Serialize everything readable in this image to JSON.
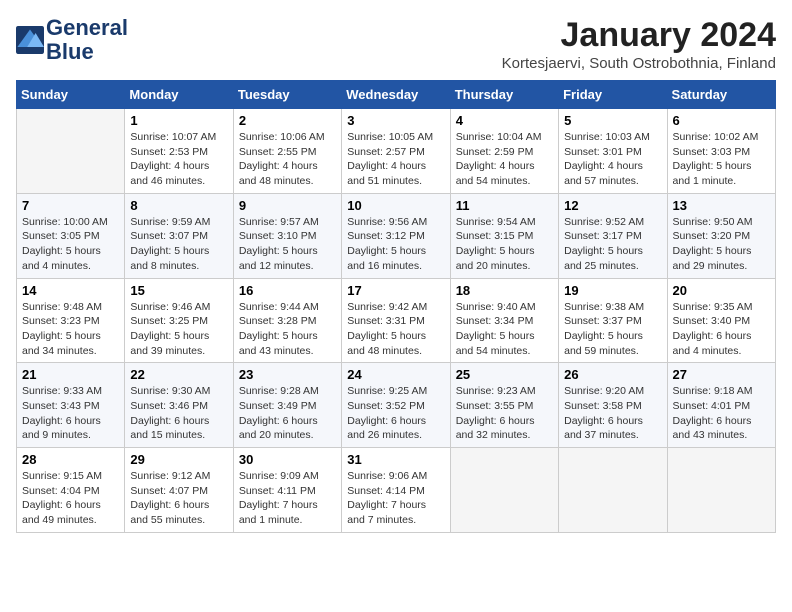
{
  "logo": {
    "line1": "General",
    "line2": "Blue"
  },
  "title": "January 2024",
  "subtitle": "Kortesjaervi, South Ostrobothnia, Finland",
  "weekdays": [
    "Sunday",
    "Monday",
    "Tuesday",
    "Wednesday",
    "Thursday",
    "Friday",
    "Saturday"
  ],
  "weeks": [
    [
      {
        "day": "",
        "info": ""
      },
      {
        "day": "1",
        "info": "Sunrise: 10:07 AM\nSunset: 2:53 PM\nDaylight: 4 hours\nand 46 minutes."
      },
      {
        "day": "2",
        "info": "Sunrise: 10:06 AM\nSunset: 2:55 PM\nDaylight: 4 hours\nand 48 minutes."
      },
      {
        "day": "3",
        "info": "Sunrise: 10:05 AM\nSunset: 2:57 PM\nDaylight: 4 hours\nand 51 minutes."
      },
      {
        "day": "4",
        "info": "Sunrise: 10:04 AM\nSunset: 2:59 PM\nDaylight: 4 hours\nand 54 minutes."
      },
      {
        "day": "5",
        "info": "Sunrise: 10:03 AM\nSunset: 3:01 PM\nDaylight: 4 hours\nand 57 minutes."
      },
      {
        "day": "6",
        "info": "Sunrise: 10:02 AM\nSunset: 3:03 PM\nDaylight: 5 hours\nand 1 minute."
      }
    ],
    [
      {
        "day": "7",
        "info": "Sunrise: 10:00 AM\nSunset: 3:05 PM\nDaylight: 5 hours\nand 4 minutes."
      },
      {
        "day": "8",
        "info": "Sunrise: 9:59 AM\nSunset: 3:07 PM\nDaylight: 5 hours\nand 8 minutes."
      },
      {
        "day": "9",
        "info": "Sunrise: 9:57 AM\nSunset: 3:10 PM\nDaylight: 5 hours\nand 12 minutes."
      },
      {
        "day": "10",
        "info": "Sunrise: 9:56 AM\nSunset: 3:12 PM\nDaylight: 5 hours\nand 16 minutes."
      },
      {
        "day": "11",
        "info": "Sunrise: 9:54 AM\nSunset: 3:15 PM\nDaylight: 5 hours\nand 20 minutes."
      },
      {
        "day": "12",
        "info": "Sunrise: 9:52 AM\nSunset: 3:17 PM\nDaylight: 5 hours\nand 25 minutes."
      },
      {
        "day": "13",
        "info": "Sunrise: 9:50 AM\nSunset: 3:20 PM\nDaylight: 5 hours\nand 29 minutes."
      }
    ],
    [
      {
        "day": "14",
        "info": "Sunrise: 9:48 AM\nSunset: 3:23 PM\nDaylight: 5 hours\nand 34 minutes."
      },
      {
        "day": "15",
        "info": "Sunrise: 9:46 AM\nSunset: 3:25 PM\nDaylight: 5 hours\nand 39 minutes."
      },
      {
        "day": "16",
        "info": "Sunrise: 9:44 AM\nSunset: 3:28 PM\nDaylight: 5 hours\nand 43 minutes."
      },
      {
        "day": "17",
        "info": "Sunrise: 9:42 AM\nSunset: 3:31 PM\nDaylight: 5 hours\nand 48 minutes."
      },
      {
        "day": "18",
        "info": "Sunrise: 9:40 AM\nSunset: 3:34 PM\nDaylight: 5 hours\nand 54 minutes."
      },
      {
        "day": "19",
        "info": "Sunrise: 9:38 AM\nSunset: 3:37 PM\nDaylight: 5 hours\nand 59 minutes."
      },
      {
        "day": "20",
        "info": "Sunrise: 9:35 AM\nSunset: 3:40 PM\nDaylight: 6 hours\nand 4 minutes."
      }
    ],
    [
      {
        "day": "21",
        "info": "Sunrise: 9:33 AM\nSunset: 3:43 PM\nDaylight: 6 hours\nand 9 minutes."
      },
      {
        "day": "22",
        "info": "Sunrise: 9:30 AM\nSunset: 3:46 PM\nDaylight: 6 hours\nand 15 minutes."
      },
      {
        "day": "23",
        "info": "Sunrise: 9:28 AM\nSunset: 3:49 PM\nDaylight: 6 hours\nand 20 minutes."
      },
      {
        "day": "24",
        "info": "Sunrise: 9:25 AM\nSunset: 3:52 PM\nDaylight: 6 hours\nand 26 minutes."
      },
      {
        "day": "25",
        "info": "Sunrise: 9:23 AM\nSunset: 3:55 PM\nDaylight: 6 hours\nand 32 minutes."
      },
      {
        "day": "26",
        "info": "Sunrise: 9:20 AM\nSunset: 3:58 PM\nDaylight: 6 hours\nand 37 minutes."
      },
      {
        "day": "27",
        "info": "Sunrise: 9:18 AM\nSunset: 4:01 PM\nDaylight: 6 hours\nand 43 minutes."
      }
    ],
    [
      {
        "day": "28",
        "info": "Sunrise: 9:15 AM\nSunset: 4:04 PM\nDaylight: 6 hours\nand 49 minutes."
      },
      {
        "day": "29",
        "info": "Sunrise: 9:12 AM\nSunset: 4:07 PM\nDaylight: 6 hours\nand 55 minutes."
      },
      {
        "day": "30",
        "info": "Sunrise: 9:09 AM\nSunset: 4:11 PM\nDaylight: 7 hours\nand 1 minute."
      },
      {
        "day": "31",
        "info": "Sunrise: 9:06 AM\nSunset: 4:14 PM\nDaylight: 7 hours\nand 7 minutes."
      },
      {
        "day": "",
        "info": ""
      },
      {
        "day": "",
        "info": ""
      },
      {
        "day": "",
        "info": ""
      }
    ]
  ]
}
